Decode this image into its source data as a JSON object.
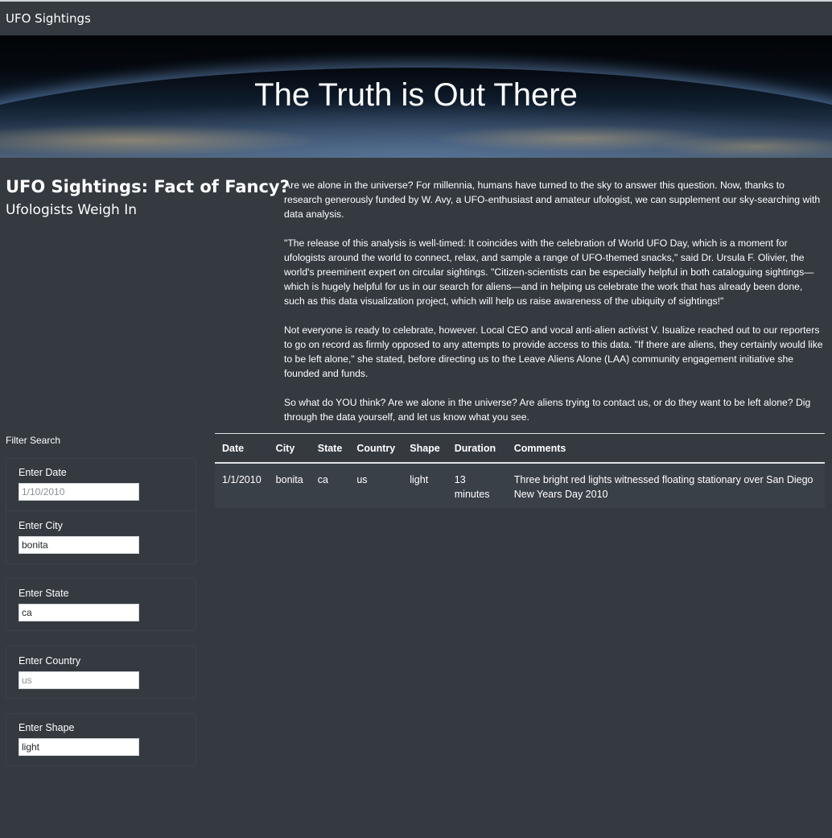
{
  "navbar": {
    "brand": "UFO Sightings"
  },
  "hero": {
    "title": "The Truth is Out There"
  },
  "intro": {
    "headline": "UFO Sightings: Fact of Fancy?",
    "subheadline": "Ufologists Weigh In",
    "paragraphs": [
      "Are we alone in the universe? For millennia, humans have turned to the sky to answer this question. Now, thanks to research generously funded by W. Avy, a UFO-enthusiast and amateur ufologist, we can supplement our sky-searching with data analysis.",
      "\"The release of this analysis is well-timed: It coincides with the celebration of World UFO Day, which is a moment for ufologists around the world to connect, relax, and sample a range of UFO-themed snacks,\" said Dr. Ursula F. Olivier, the world's preeminent expert on circular sightings. \"Citizen-scientists can be especially helpful in both cataloguing sightings—which is hugely helpful for us in our search for aliens—and in helping us celebrate the work that has already been done, such as this data visualization project, which will help us raise awareness of the ubiquity of sightings!\"",
      "Not everyone is ready to celebrate, however. Local CEO and vocal anti-alien activist V. Isualize reached out to our reporters to go on record as firmly opposed to any attempts to provide access to this data. \"If there are aliens, they certainly would like to be left alone,\" she stated, before directing us to the Leave Aliens Alone (LAA) community engagement initiative she founded and funds.",
      "So what do YOU think? Are we alone in the universe? Are aliens trying to contact us, or do they want to be left alone? Dig through the data yourself, and let us know what you see."
    ]
  },
  "filters": {
    "title": "Filter Search",
    "date": {
      "label": "Enter Date",
      "value": "",
      "placeholder": "1/10/2010"
    },
    "city": {
      "label": "Enter City",
      "value": "bonita",
      "placeholder": ""
    },
    "state": {
      "label": "Enter State",
      "value": "ca",
      "placeholder": ""
    },
    "country": {
      "label": "Enter Country",
      "value": "",
      "placeholder": "us"
    },
    "shape": {
      "label": "Enter Shape",
      "value": "light",
      "placeholder": ""
    }
  },
  "table": {
    "headers": [
      "Date",
      "City",
      "State",
      "Country",
      "Shape",
      "Duration",
      "Comments"
    ],
    "rows": [
      [
        "1/1/2010",
        "bonita",
        "ca",
        "us",
        "light",
        "13 minutes",
        "Three bright red lights witnessed floating stationary over San Diego New Years Day 2010"
      ]
    ]
  }
}
